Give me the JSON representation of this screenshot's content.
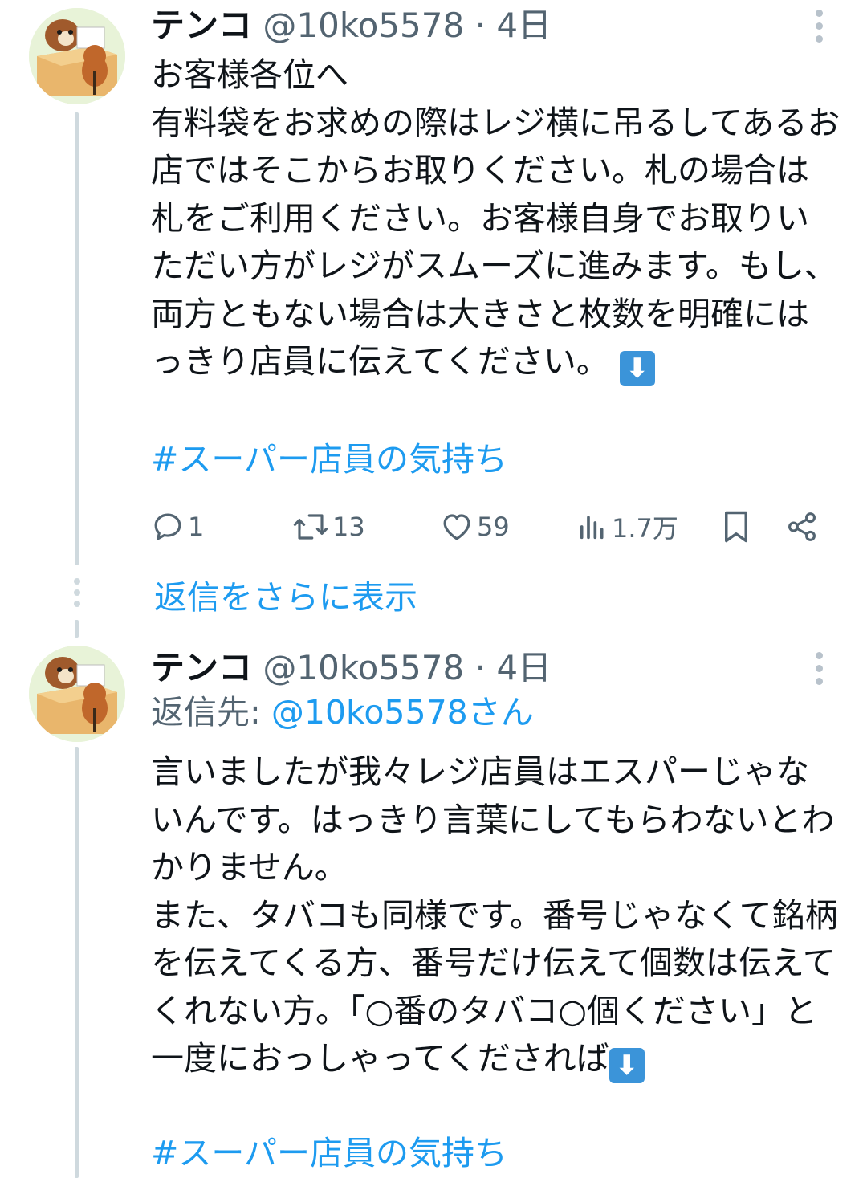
{
  "tweets": [
    {
      "name": "テンコ",
      "handle": "@10ko5578",
      "separator": "·",
      "time": "4日",
      "text": "お客様各位へ\n有料袋をお求めの際はレジ横に吊るしてあるお店ではそこからお取りください。札の場合は札をご利用ください。お客様自身でお取りいただい方がレジがスムーズに進みます。もし、両方ともない場合は大きさと枚数を明確にはっきり店員に伝えてください。",
      "emoji": "⬇",
      "hashtag": "#スーパー店員の気持ち",
      "actions": {
        "reply_count": "1",
        "retweet_count": "13",
        "like_count": "59",
        "views_count": "1.7万"
      }
    },
    {
      "name": "テンコ",
      "handle": "@10ko5578",
      "separator": "·",
      "time": "4日",
      "reply_to_label": "返信先:",
      "reply_to_user": "@10ko5578さん",
      "text": "言いましたが我々レジ店員はエスパーじゃないんです。はっきり言葉にしてもらわないとわかりません。\nまた、タバコも同様です。番号じゃなくて銘柄を伝えてくる方、番号だけ伝えて個数は伝えてくれない方。「○番のタバコ○個ください」と一度におっしゃってくだされば",
      "emoji": "⬇",
      "hashtag": "#スーパー店員の気持ち"
    }
  ],
  "show_more_replies": "返信をさらに表示",
  "colors": {
    "link": "#1d9bf0",
    "secondary_text": "#536471",
    "thread_line": "#cfd9de"
  },
  "icons": [
    "reply-icon",
    "retweet-icon",
    "like-icon",
    "views-icon",
    "bookmark-icon",
    "share-icon",
    "more-icon",
    "arrow-down-emoji"
  ]
}
